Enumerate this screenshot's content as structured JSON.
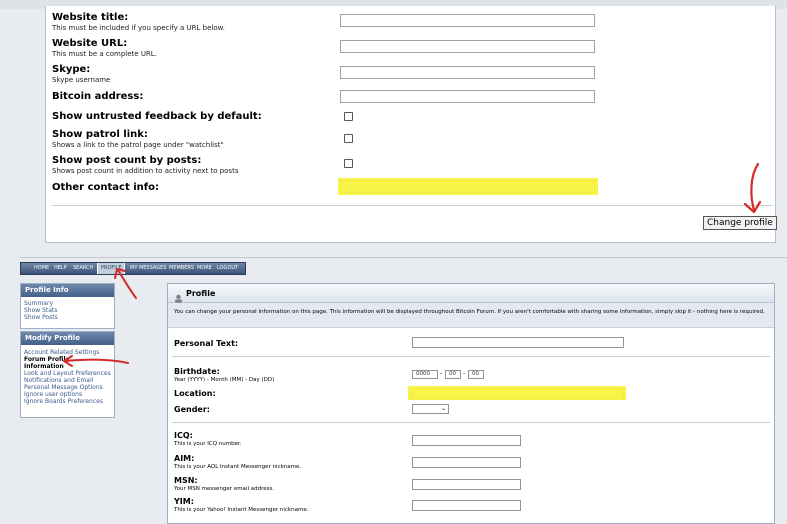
{
  "settings_form": {
    "fields": [
      {
        "label": "Website title:",
        "sub": "This must be included if you specify a URL below.",
        "type": "text"
      },
      {
        "label": "Website URL:",
        "sub": "This must be a complete URL.",
        "type": "text"
      },
      {
        "label": "Skype:",
        "sub": "Skype username",
        "type": "text"
      },
      {
        "label": "Bitcoin address:",
        "sub": "",
        "type": "text"
      },
      {
        "label": "Show untrusted feedback by default:",
        "sub": "",
        "type": "checkbox",
        "checked": false
      },
      {
        "label": "Show patrol link:",
        "sub": "Shows a link to the patrol page under \"watchlist\"",
        "type": "checkbox",
        "checked": false
      },
      {
        "label": "Show post count by posts:",
        "sub": "Shows post count in addition to activity next to posts",
        "type": "checkbox",
        "checked": false
      },
      {
        "label": "Other contact info:",
        "sub": "",
        "type": "text",
        "highlighted": true
      }
    ],
    "submit_label": "Change profile"
  },
  "navbar": {
    "items": [
      "HOME",
      "HELP",
      "SEARCH",
      "PROFILE",
      "MY MESSAGES",
      "MEMBERS",
      "MORE",
      "LOGOUT"
    ],
    "active": "PROFILE"
  },
  "sidebar": {
    "profile_info": {
      "title": "Profile Info",
      "links": [
        "Summary",
        "Show Stats",
        "Show Posts"
      ]
    },
    "modify_profile": {
      "title": "Modify Profile",
      "links": [
        "Account Related Settings",
        "Forum Profile",
        "Information",
        "Look and Layout Preferences",
        "Notifications and Email",
        "Personal Message Options",
        "Ignore user options",
        "Ignore Boards Preferences"
      ],
      "current": [
        "Forum Profile",
        "Information"
      ]
    }
  },
  "profile_panel": {
    "title": "Profile",
    "description": "You can change your personal information on this page. This information will be displayed throughout Bitcoin Forum. If you aren't comfortable with sharing some information, simply skip it - nothing here is required.",
    "personal_text": {
      "label": "Personal Text:"
    },
    "birthdate": {
      "label": "Birthdate:",
      "sub": "Year (YYYY) - Month (MM) - Day (DD)",
      "year": "0000",
      "month": "00",
      "day": "00"
    },
    "location": {
      "label": "Location:"
    },
    "gender": {
      "label": "Gender:"
    },
    "messengers": [
      {
        "label": "ICQ:",
        "sub": "This is your ICQ number."
      },
      {
        "label": "AIM:",
        "sub": "This is your AOL Instant Messenger nickname."
      },
      {
        "label": "MSN:",
        "sub": "Your MSN messenger email address."
      },
      {
        "label": "YIM:",
        "sub": "This is your Yahoo! Instant Messenger nickname."
      }
    ]
  },
  "colors": {
    "highlight": "#f6f23a",
    "annotation": "#d42a2a",
    "nav": "#44608a"
  }
}
